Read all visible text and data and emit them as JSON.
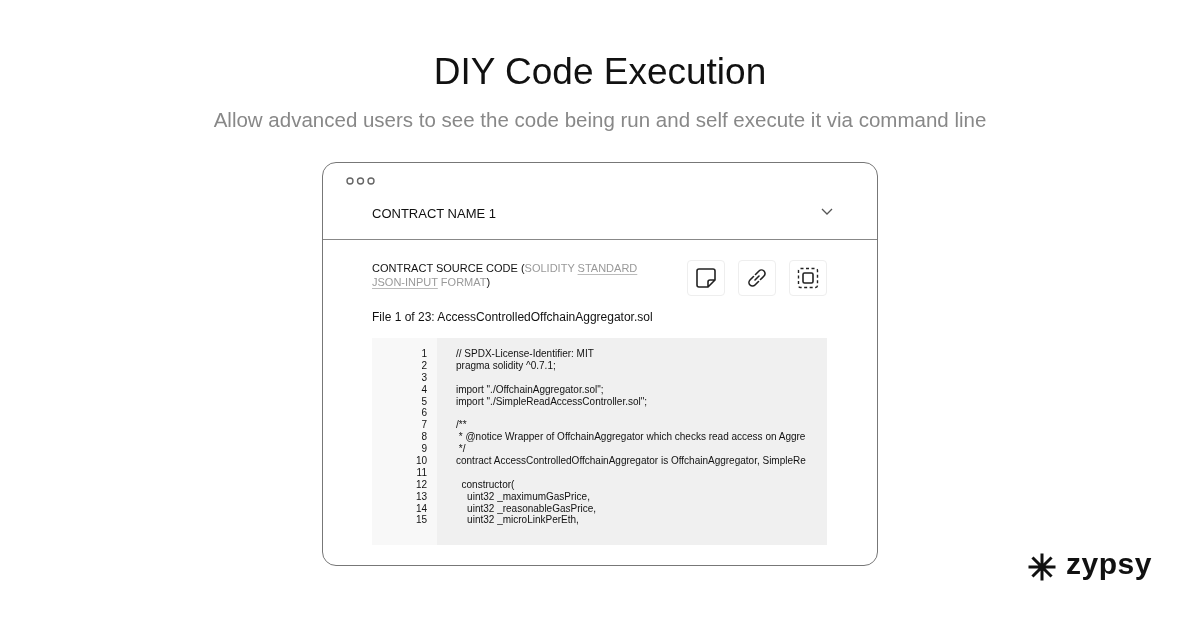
{
  "title": "DIY Code Execution",
  "subtitle": "Allow advanced users to see the code being run and self execute it via command line",
  "card": {
    "contract_name": "CONTRACT NAME 1",
    "source_heading": [
      {
        "kind": "plain",
        "text": "CONTRACT SOURCE CODE ("
      },
      {
        "kind": "muted",
        "text": "SOLIDITY "
      },
      {
        "kind": "link",
        "text": "STANDARD"
      },
      {
        "kind": "link",
        "text": "JSON-INPUT"
      },
      {
        "kind": "muted",
        "text": " FORMAT"
      },
      {
        "kind": "plain",
        "text": ")"
      }
    ],
    "file_label": "File 1 of 23: AccessControlledOffchainAggregator.sol",
    "code_lines": [
      {
        "number": "1",
        "text": "// SPDX-License-Identifier: MIT"
      },
      {
        "number": "2",
        "text": "pragma solidity ^0.7.1;"
      },
      {
        "number": "3"
      },
      {
        "number": "4",
        "text": "import \"./OffchainAggregator.sol\";"
      },
      {
        "number": "5",
        "text": "import \"./SimpleReadAccessController.sol\";"
      },
      {
        "number": "6"
      },
      {
        "number": "7",
        "text": "/**"
      },
      {
        "number": "8",
        "text": " * @notice Wrapper of OffchainAggregator which checks read access on Aggre"
      },
      {
        "number": "9",
        "text": " */"
      },
      {
        "number": "10",
        "text": "contract AccessControlledOffchainAggregator is OffchainAggregator, SimpleRe"
      },
      {
        "number": "11"
      },
      {
        "number": "12",
        "text": "  constructor("
      },
      {
        "number": "13",
        "text": "    uint32 _maximumGasPrice,"
      },
      {
        "number": "14",
        "text": "    uint32 _reasonableGasPrice,"
      },
      {
        "number": "15",
        "text": "    uint32 _microLinkPerEth,"
      }
    ]
  },
  "brand": "zypsy"
}
